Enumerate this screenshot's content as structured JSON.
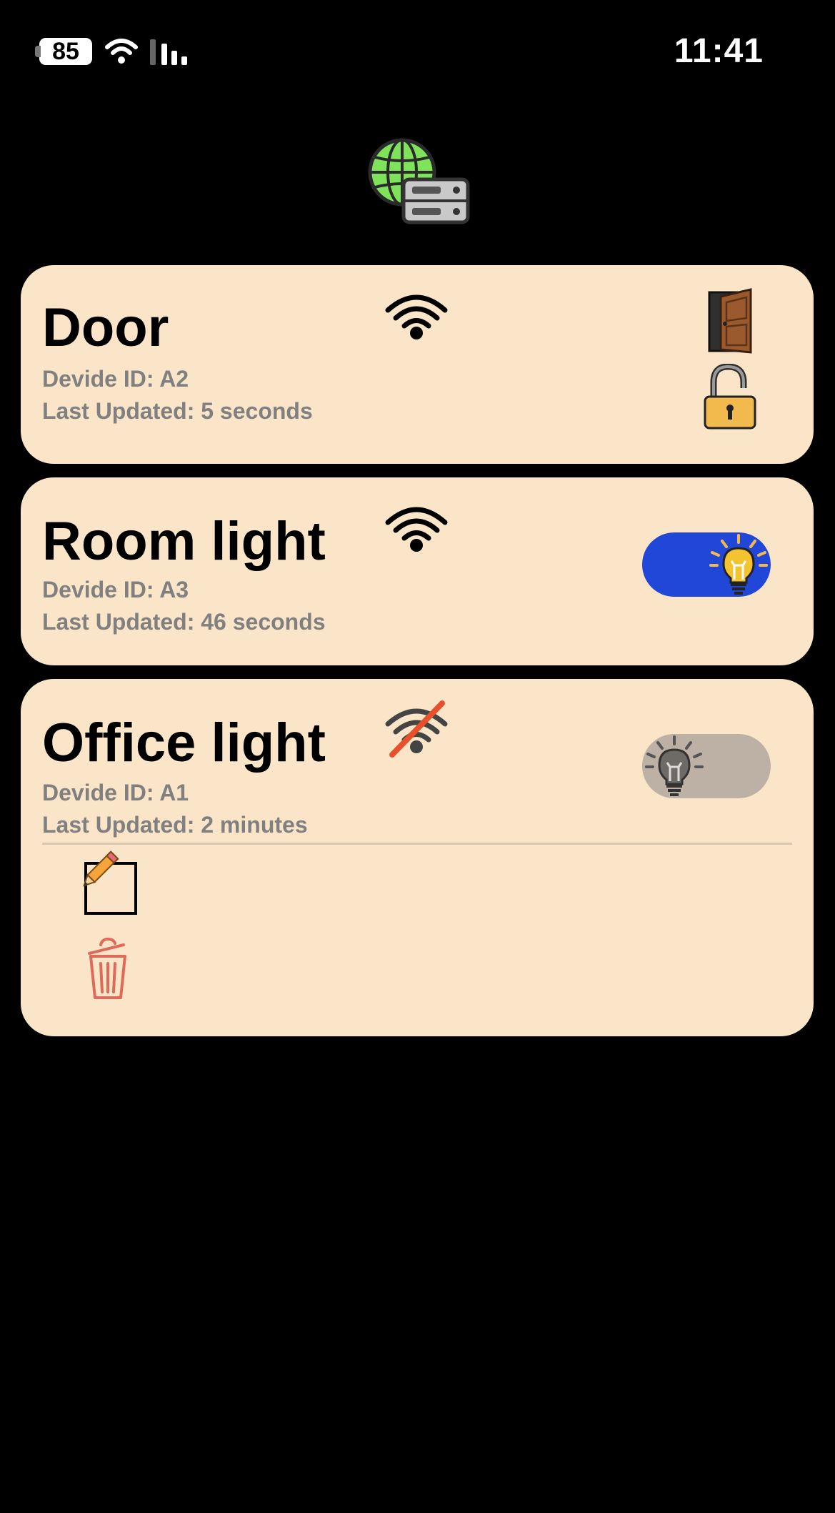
{
  "status_bar": {
    "battery": "85",
    "time": "11:41"
  },
  "app": {
    "logo_icon": "globe-server-icon"
  },
  "devices": [
    {
      "name": "Door",
      "device_id": "Devide ID: A2",
      "last_updated": "Last Updated: 5 seconds",
      "connection": "online",
      "type_icon": "door-icon",
      "state_icon": "unlocked-padlock-icon"
    },
    {
      "name": "Room light",
      "device_id": "Devide ID: A3",
      "last_updated": "Last Updated: 46 seconds",
      "connection": "online",
      "toggle_on": true,
      "toggle_icon": "lightbulb-on-icon"
    },
    {
      "name": "Office light",
      "device_id": "Devide ID: A1",
      "last_updated": "Last Updated: 2 minutes",
      "connection": "offline",
      "toggle_on": false,
      "toggle_icon": "lightbulb-off-icon",
      "actions": [
        "edit-icon",
        "trash-icon"
      ]
    }
  ],
  "colors": {
    "background": "#000000",
    "card": "#fbe5c8",
    "meta_text": "#808080",
    "toggle_on": "#2047d8",
    "toggle_off": "#bdb1a6",
    "offline_slash": "#e8502c",
    "delete": "#e06a5a"
  }
}
